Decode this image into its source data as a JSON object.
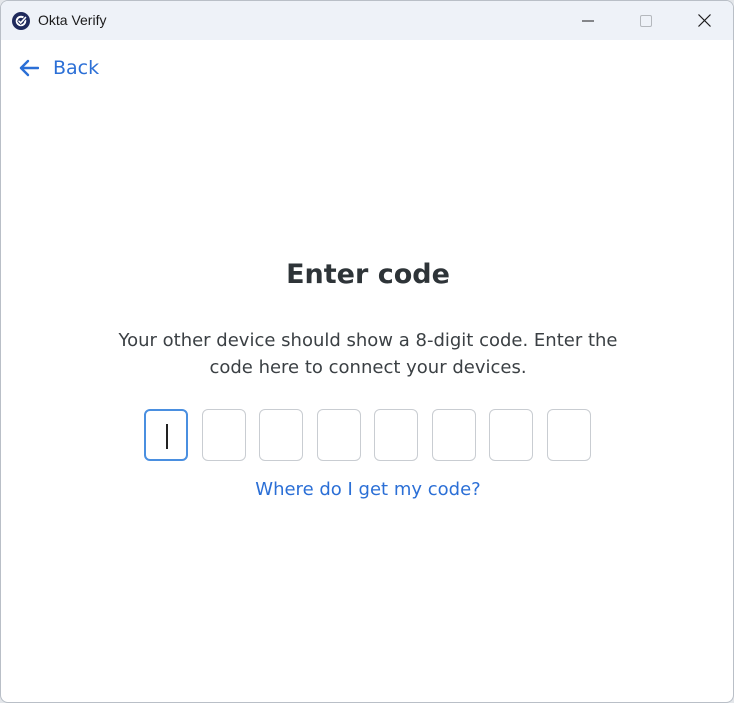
{
  "window": {
    "title": "Okta Verify"
  },
  "nav": {
    "back_label": "Back"
  },
  "main": {
    "heading": "Enter code",
    "description": "Your other device should show a 8-digit code. Enter the code here to connect your devices.",
    "code_digits": [
      "",
      "",
      "",
      "",
      "",
      "",
      "",
      ""
    ],
    "active_digit_index": 0,
    "help_link": "Where do I get my code?"
  },
  "colors": {
    "accent": "#2b6fd6",
    "active_border": "#4a8fe0",
    "titlebar": "#eef2f8",
    "app_icon": "#1f2a5c"
  },
  "icons": {
    "app": "okta-verify-icon",
    "back": "arrow-left-icon",
    "minimize": "minimize-icon",
    "maximize": "maximize-icon",
    "close": "close-icon"
  }
}
